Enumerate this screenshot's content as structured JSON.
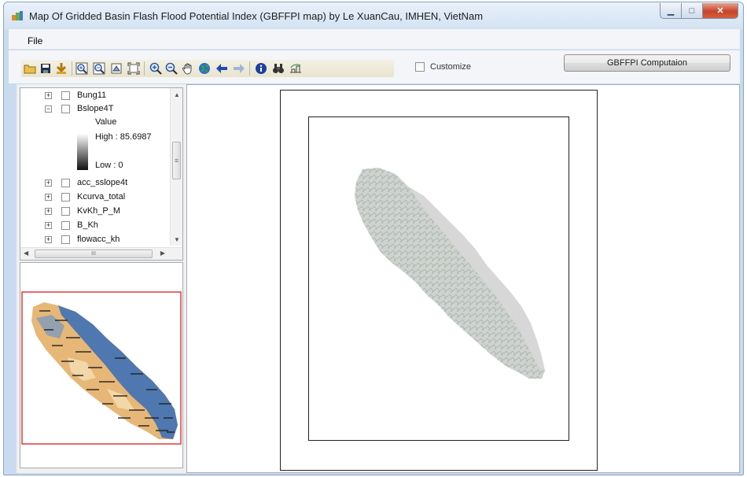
{
  "window": {
    "title": "Map Of Gridded Basin Flash Flood Potential Index (GBFFPI map) by Le XuanCau, IMHEN, VietNam",
    "minimize_label": "▁",
    "maximize_label": "□",
    "close_label": "✕"
  },
  "menu": {
    "file_label": "File"
  },
  "toolbar": {
    "icons": [
      "open-folder-icon",
      "save-icon",
      "add-data-icon",
      "zoom-in-box-icon",
      "zoom-out-box-icon",
      "zoom-to-layer-icon",
      "full-extent-icon",
      "zoom-in-icon",
      "zoom-out-icon",
      "pan-hand-icon",
      "globe-icon",
      "back-arrow-icon",
      "forward-arrow-icon",
      "identify-icon",
      "find-binoculars-icon",
      "measure-icon"
    ],
    "customize_label": "Customize",
    "computation_button_label": "GBFFPI Computaion"
  },
  "toc": {
    "layers": [
      {
        "name": "Bung11",
        "expanded": false,
        "checked": false
      },
      {
        "name": "Bslope4T",
        "expanded": true,
        "checked": false
      }
    ],
    "legend": {
      "value_label": "Value",
      "high_label": "High : 85.6987",
      "low_label": "Low : 0"
    },
    "more_layers": [
      {
        "name": "acc_sslope4t",
        "expanded": false,
        "checked": false
      },
      {
        "name": "Kcurva_total",
        "expanded": false,
        "checked": false
      },
      {
        "name": "KvKh_P_M",
        "expanded": false,
        "checked": false
      },
      {
        "name": "B_Kh",
        "expanded": false,
        "checked": false
      },
      {
        "name": "flowacc_kh",
        "expanded": false,
        "checked": false
      }
    ],
    "scroll_grip": "≡",
    "hscroll_grip": "III"
  },
  "colors": {
    "basin_fill": "#cfd3cf",
    "overview_extent": "#e03a3a",
    "overview_blue": "#4f77b0",
    "overview_orange": "#e6b777"
  }
}
